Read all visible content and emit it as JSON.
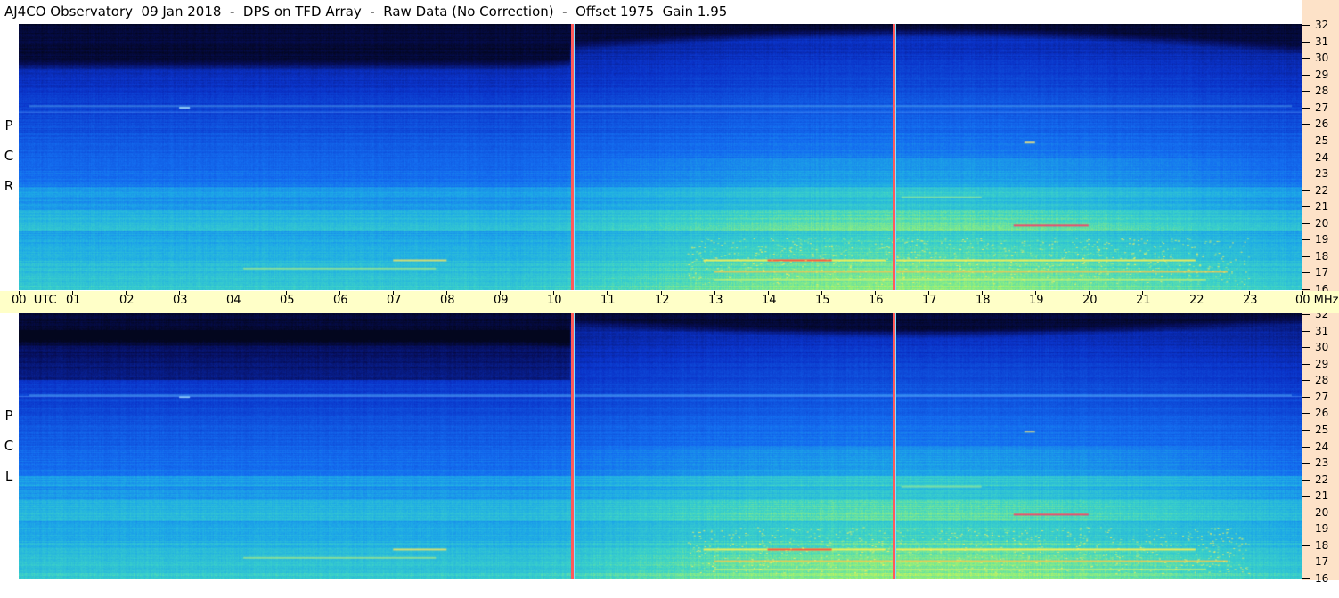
{
  "title": "AJ4CO Observatory  09 Jan 2018  -  DPS on TFD Array  -  Raw Data (No Correction)  -  Offset 1975  Gain 1.95",
  "panels": [
    {
      "name": "rcp",
      "label_letters": [
        "P",
        "C",
        "R"
      ]
    },
    {
      "name": "lcp",
      "label_letters": [
        "P",
        "C",
        "L"
      ]
    }
  ],
  "time_axis": {
    "labels": [
      "00  UTC",
      "01",
      "02",
      "03",
      "04",
      "05",
      "06",
      "07",
      "08",
      "09",
      "10",
      "11",
      "12",
      "13",
      "14",
      "15",
      "16",
      "17",
      "18",
      "19",
      "20",
      "21",
      "22",
      "23",
      "00 MHz"
    ],
    "hours": [
      0,
      1,
      2,
      3,
      4,
      5,
      6,
      7,
      8,
      9,
      10,
      11,
      12,
      13,
      14,
      15,
      16,
      17,
      18,
      19,
      20,
      21,
      22,
      23,
      24
    ],
    "unit": "UTC"
  },
  "freq_axis": {
    "labels": [
      "32",
      "31",
      "30",
      "29",
      "28",
      "27",
      "26",
      "25",
      "24",
      "23",
      "22",
      "21",
      "20",
      "19",
      "18",
      "17",
      "16"
    ],
    "mhz": [
      32,
      31,
      30,
      29,
      28,
      27,
      26,
      25,
      24,
      23,
      22,
      21,
      20,
      19,
      18,
      17,
      16
    ],
    "unit": "MHz"
  },
  "markers_utc": [
    10.35,
    16.35
  ],
  "colors": {
    "background": "#ffffff",
    "axis_band": "#ffffc8",
    "freq_band": "#fde2c8",
    "marker": "#ff5a5a",
    "spectrogram_low": "#050a2a",
    "spectrogram_high": "#ffff60"
  },
  "chart_data": {
    "type": "heatmap",
    "title": "AJ4CO Observatory  09 Jan 2018  -  DPS on TFD Array  -  Raw Data (No Correction)  -  Offset 1975  Gain 1.95",
    "x": {
      "label": "UTC",
      "range": [
        0,
        24
      ]
    },
    "y": {
      "label": "MHz",
      "range": [
        16,
        32
      ]
    },
    "series": [
      {
        "name": "R C P"
      },
      {
        "name": "L C P"
      }
    ],
    "markers_utc": [
      10.35,
      16.35
    ]
  }
}
